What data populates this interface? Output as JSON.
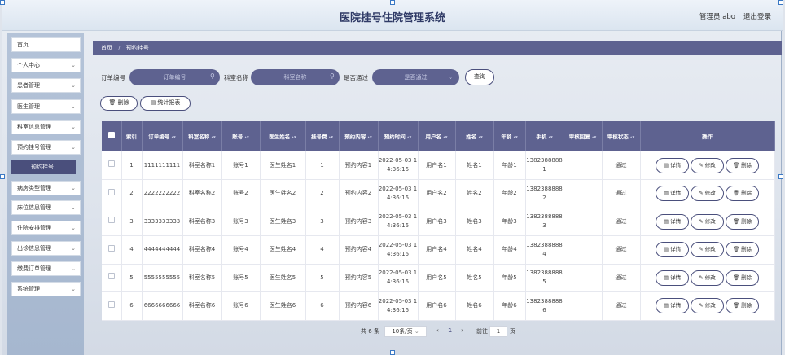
{
  "header": {
    "title": "医院挂号住院管理系统",
    "user": "管理员 abo",
    "logout": "退出登录"
  },
  "sidebar": {
    "items": [
      {
        "label": "首页",
        "has_chevron": false
      },
      {
        "label": "个人中心",
        "has_chevron": true
      },
      {
        "label": "患者管理",
        "has_chevron": true
      },
      {
        "label": "医生管理",
        "has_chevron": true
      },
      {
        "label": "科室信息管理",
        "has_chevron": true
      },
      {
        "label": "预约挂号管理",
        "has_chevron": true
      },
      {
        "label": "病房类型管理",
        "has_chevron": true
      },
      {
        "label": "床位信息管理",
        "has_chevron": true
      },
      {
        "label": "住院安排管理",
        "has_chevron": true
      },
      {
        "label": "出诊信息管理",
        "has_chevron": true
      },
      {
        "label": "缴费订单管理",
        "has_chevron": true
      },
      {
        "label": "系统管理",
        "has_chevron": true
      }
    ],
    "active_sub": "预约挂号"
  },
  "breadcrumb": {
    "home": "首页",
    "sep": "/",
    "current": "预约挂号"
  },
  "search": {
    "order_label": "订单编号",
    "order_placeholder": "订单编号",
    "dept_label": "科室名称",
    "dept_placeholder": "科室名称",
    "approved_label": "是否通过",
    "approved_value": "是否通过",
    "query_button": "查询"
  },
  "toolbar": {
    "delete_label": "删除",
    "stats_label": "统计报表"
  },
  "table": {
    "headers": [
      {
        "label": "",
        "sortable": false
      },
      {
        "label": "索引",
        "sortable": false
      },
      {
        "label": "订单编号",
        "sortable": true
      },
      {
        "label": "科室名称",
        "sortable": true
      },
      {
        "label": "账号",
        "sortable": true
      },
      {
        "label": "医生姓名",
        "sortable": true
      },
      {
        "label": "挂号费",
        "sortable": true
      },
      {
        "label": "预约内容",
        "sortable": true
      },
      {
        "label": "预约时间",
        "sortable": true
      },
      {
        "label": "用户名",
        "sortable": true
      },
      {
        "label": "姓名",
        "sortable": true
      },
      {
        "label": "年龄",
        "sortable": true
      },
      {
        "label": "手机",
        "sortable": true
      },
      {
        "label": "审核回复",
        "sortable": true
      },
      {
        "label": "审核状态",
        "sortable": true
      },
      {
        "label": "操作",
        "sortable": false
      }
    ],
    "rows": [
      {
        "index": "1",
        "order": "1111111111",
        "dept": "科室名称1",
        "account": "账号1",
        "doctor": "医生姓名1",
        "fee": "1",
        "content": "预约内容1",
        "time": "2022-05-03 14:36:16",
        "username": "用户名1",
        "name": "姓名1",
        "age": "年龄1",
        "phone": "13823888881",
        "reply": "",
        "status": "通过"
      },
      {
        "index": "2",
        "order": "2222222222",
        "dept": "科室名称2",
        "account": "账号2",
        "doctor": "医生姓名2",
        "fee": "2",
        "content": "预约内容2",
        "time": "2022-05-03 14:36:16",
        "username": "用户名2",
        "name": "姓名2",
        "age": "年龄2",
        "phone": "13823888882",
        "reply": "",
        "status": "通过"
      },
      {
        "index": "3",
        "order": "3333333333",
        "dept": "科室名称3",
        "account": "账号3",
        "doctor": "医生姓名3",
        "fee": "3",
        "content": "预约内容3",
        "time": "2022-05-03 14:36:16",
        "username": "用户名3",
        "name": "姓名3",
        "age": "年龄3",
        "phone": "13823888883",
        "reply": "",
        "status": "通过"
      },
      {
        "index": "4",
        "order": "4444444444",
        "dept": "科室名称4",
        "account": "账号4",
        "doctor": "医生姓名4",
        "fee": "4",
        "content": "预约内容4",
        "time": "2022-05-03 14:36:16",
        "username": "用户名4",
        "name": "姓名4",
        "age": "年龄4",
        "phone": "13823888884",
        "reply": "",
        "status": "通过"
      },
      {
        "index": "5",
        "order": "5555555555",
        "dept": "科室名称5",
        "account": "账号5",
        "doctor": "医生姓名5",
        "fee": "5",
        "content": "预约内容5",
        "time": "2022-05-03 14:36:16",
        "username": "用户名5",
        "name": "姓名5",
        "age": "年龄5",
        "phone": "13823888885",
        "reply": "",
        "status": "通过"
      },
      {
        "index": "6",
        "order": "6666666666",
        "dept": "科室名称6",
        "account": "账号6",
        "doctor": "医生姓名6",
        "fee": "6",
        "content": "预约内容6",
        "time": "2022-05-03 14:36:16",
        "username": "用户名6",
        "name": "姓名6",
        "age": "年龄6",
        "phone": "13823888886",
        "reply": "",
        "status": "通过"
      }
    ],
    "actions": {
      "detail": "详情",
      "edit": "修改",
      "delete": "删除"
    }
  },
  "pagination": {
    "total": "共 6 条",
    "page_size": "10条/页",
    "current_page": "1",
    "goto_label": "前往",
    "goto_value": "1",
    "page_suffix": "页"
  },
  "colors": {
    "primary": "#5e6290",
    "active_sub": "#4a4f7c",
    "sidebar": "#a6b7cf"
  },
  "icons": [
    "search-icon",
    "trash-icon",
    "chart-icon",
    "detail-icon",
    "edit-icon",
    "chevron-down-icon",
    "chevron-left-icon",
    "chevron-right-icon"
  ]
}
